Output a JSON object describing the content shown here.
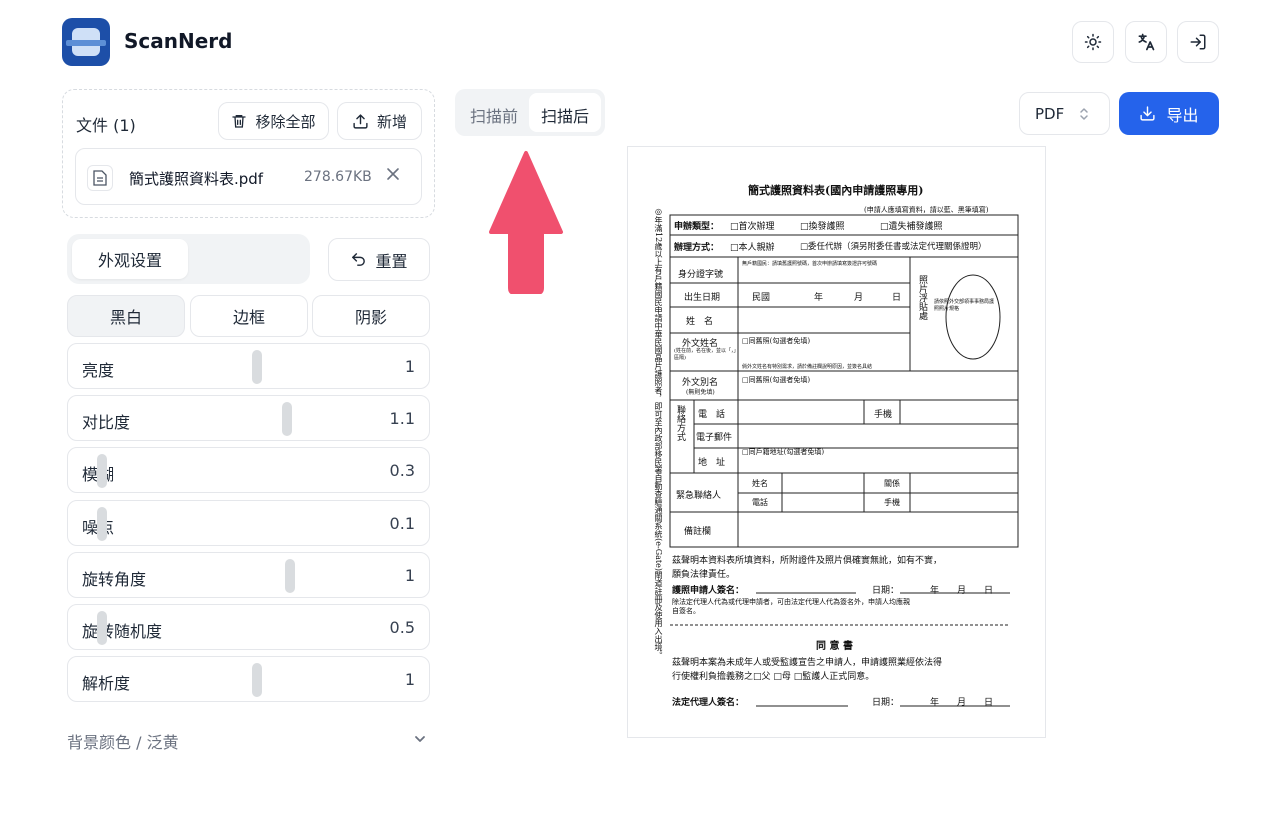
{
  "app": {
    "name": "ScanNerd"
  },
  "header": {
    "icons": [
      "sun-icon",
      "translate-icon",
      "login-icon"
    ]
  },
  "files": {
    "title": "文件 (1)",
    "remove_all_label": "移除全部",
    "add_label": "新增",
    "items": [
      {
        "name": "簡式護照資料表.pdf",
        "size": "278.67KB"
      }
    ]
  },
  "appearance": {
    "tab_label": "外观设置",
    "reset_label": "重置",
    "modes": [
      "黑白",
      "边框",
      "阴影"
    ],
    "active_mode": "黑白",
    "sliders": [
      {
        "label": "亮度",
        "value": "1",
        "fraction": 0.5
      },
      {
        "label": "对比度",
        "value": "1.1",
        "fraction": 0.59
      },
      {
        "label": "模糊",
        "value": "0.3",
        "fraction": 0.04
      },
      {
        "label": "噪点",
        "value": "0.1",
        "fraction": 0.04
      },
      {
        "label": "旋转角度",
        "value": "1",
        "fraction": 0.6
      },
      {
        "label": "旋转随机度",
        "value": "0.5",
        "fraction": 0.04
      },
      {
        "label": "解析度",
        "value": "1",
        "fraction": 0.5
      }
    ],
    "background_label": "背景颜色 / 泛黄"
  },
  "preview": {
    "tabs": [
      "扫描前",
      "扫描后"
    ],
    "active_tab": "扫描后",
    "format": "PDF",
    "export_label": "导出"
  },
  "document": {
    "title": "簡式護照資料表(國內申請護照專用)",
    "note": "(申請人應填寫資料，請以藍、黑筆填寫)",
    "side_text": "◎年滿12歲以上有戶籍國民申請中華民國晶片護照者，即可至內政部移民署自動查驗通關系統(e-Gate)閘道註冊及使用入出境。",
    "apply_type": "申辦類型：",
    "first_apply": "首次辦理",
    "renew": "換發護照",
    "lost": "遺失補發護照",
    "method": "辦理方式：",
    "in_person": "本人親辦",
    "entrust": "委任代辦（須另附委任書或法定代理關係證明）",
    "id_no": "身分證字號",
    "id_hint": "無戶籍國民：請填舊護照號碼，首次申辦請填寫簽證許可號碼",
    "birth": "出生日期",
    "minguo": "民國",
    "year": "年",
    "month": "月",
    "day": "日",
    "name": "姓　名",
    "foreign_name": "外文姓名",
    "foreign_name_hint": "(姓在前，名在後，並以「，」區隔)",
    "same_as_old": "同舊照(勾選者免填)",
    "foreign_name_note": "倘外文姓名有特別需求，請於備註欄說明原因，並簽名具結",
    "alias": "外文別名",
    "alias_hint": "(無則免填)",
    "photo": "照片浮貼處",
    "photo_hint": "請依照外交部領事事務局護照照片規格",
    "contact": "聯絡方式",
    "phone": "電　話",
    "mobile": "手機",
    "email": "電子郵件",
    "address": "地　址",
    "same_address": "同戶籍地址(勾選者免填)",
    "emergency": "緊急聯絡人",
    "em_name": "姓名",
    "relation": "關係",
    "em_phone": "電話",
    "em_mobile": "手機",
    "remarks": "備註欄",
    "declare1": "茲聲明本資料表所填資料，所附證件及照片俱確實無訛，如有不實，",
    "declare2": "願負法律責任。",
    "sign_label": "護照申請人簽名：",
    "date_label": "日期：",
    "date_fill": "年　　月　　日",
    "sign_note1": "除法定代理人代為或代理申請者，可由法定代理人代為簽名外，申請人均應親",
    "sign_note2": "自簽名。",
    "consent_title": "同 意 書",
    "consent1": "茲聲明本案為未成年人或受監護宣告之申請人，申請護照業經依法得",
    "consent2": "行使權利負擔義務之□父 □母 □監護人正式同意。",
    "legal_sign": "法定代理人簽名："
  },
  "colors": {
    "accent": "#2563eb",
    "arrow": "#f0506e",
    "logo": "#1d4fa8"
  }
}
